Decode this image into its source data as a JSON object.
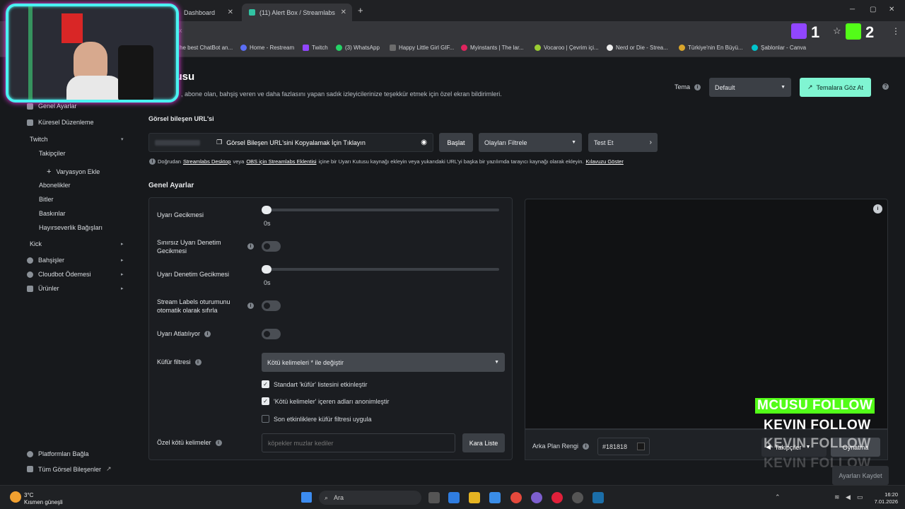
{
  "browser": {
    "tabs": [
      {
        "title": "Dashboard"
      },
      {
        "title": "(11) Alert Box / Streamlabs"
      }
    ],
    "bookmarks": [
      "he best ChatBot an...",
      "Home - Restream",
      "Twitch",
      "(3) WhatsApp",
      "Happy Little Girl GIF...",
      "Myinstants | The lar...",
      "Vocaroo | Çevrim içi...",
      "Nerd or Die - Strea...",
      "Türkiye'nin En Büyü...",
      "Şablonlar - Canva"
    ],
    "overlay_count_1": "1",
    "overlay_count_2": "2"
  },
  "sidebar": {
    "items": [
      {
        "label": "Genel Ayarlar"
      },
      {
        "label": "Küresel Düzenleme"
      },
      {
        "label": "Twitch"
      },
      {
        "label": "Takipçiler"
      },
      {
        "label": "Varyasyon Ekle"
      },
      {
        "label": "Abonelikler"
      },
      {
        "label": "Bitler"
      },
      {
        "label": "Baskınlar"
      },
      {
        "label": "Hayırseverlik Bağışları"
      },
      {
        "label": "Kick"
      },
      {
        "label": "Bahşişler"
      },
      {
        "label": "Cloudbot Ödemesi"
      },
      {
        "label": "Ürünler"
      }
    ],
    "connect": "Platformları Bağla",
    "all_widgets": "Tüm Görsel Bileşenler"
  },
  "header": {
    "title": "kutusu",
    "subtitle": ", abone olan, bahşiş veren ve daha fazlasını yapan sadık izleyicilerinize teşekkür etmek için özel ekran bildirimleri.",
    "theme_label": "Tema",
    "theme_value": "Default",
    "browse_themes": "Temalara Göz At"
  },
  "url_section": {
    "label": "Görsel bileşen URL'si",
    "copy_text": "Görsel Bileşen URL'sini Kopyalamak İçin Tıklayın",
    "start": "Başlat",
    "filter": "Olayları Filtrele",
    "test": "Test Et",
    "note_prefix": "Doğrudan",
    "note_link1": "Streamlabs Desktop",
    "note_mid1": "veya",
    "note_link2": "OBS için Streamlabs Eklentisi",
    "note_mid2": "içine bir Uyarı Kutusu kaynağı ekleyin veya yukarıdaki URL'yi başka bir yazılımda tarayıcı kaynağı olarak ekleyin.",
    "note_link3": "Kılavuzu Göster"
  },
  "general": {
    "heading": "Genel Ayarlar",
    "alert_delay": "Uyarı Gecikmesi",
    "alert_delay_value": "0s",
    "unlimited_moderation": "Sınırsız Uyarı Denetim Gecikmesi",
    "moderation_delay": "Uyarı Denetim Gecikmesi",
    "moderation_delay_value": "0s",
    "stream_labels_reset": "Stream Labels oturumunu otomatik olarak sıfırla",
    "alert_skipping": "Uyarı Atlatılıyor",
    "profanity_filter": "Küfür filtresi",
    "profanity_value": "Kötü kelimeleri * ile değiştir",
    "check1": "Standart 'küfür' listesini etkinleştir",
    "check2": "'Kötü kelimeler' içeren adları anonimleştir",
    "check3": "Son etkinliklere küfür filtresi uygula",
    "custom_bad_words": "Özel kötü kelimeler",
    "custom_placeholder": "köpekler muzlar kediler",
    "blacklist": "Kara Liste"
  },
  "preview": {
    "bg_label": "Arka Plan Rengi",
    "bg_value": "#181818",
    "followers_btn": "Takipçiler",
    "play_btn": "Oynatma",
    "save": "Ayarları Kaydet",
    "follows": [
      "MCUSU  FOLLOW",
      "KEVIN  FOLLOW",
      "KEVIN  FOLLOW",
      "KEVIN  FOLLOW"
    ]
  },
  "taskbar": {
    "temp": "3°C",
    "weather": "Kısmen güneşli",
    "search": "Ara",
    "time": "16:20",
    "date": "7.01.2026"
  }
}
